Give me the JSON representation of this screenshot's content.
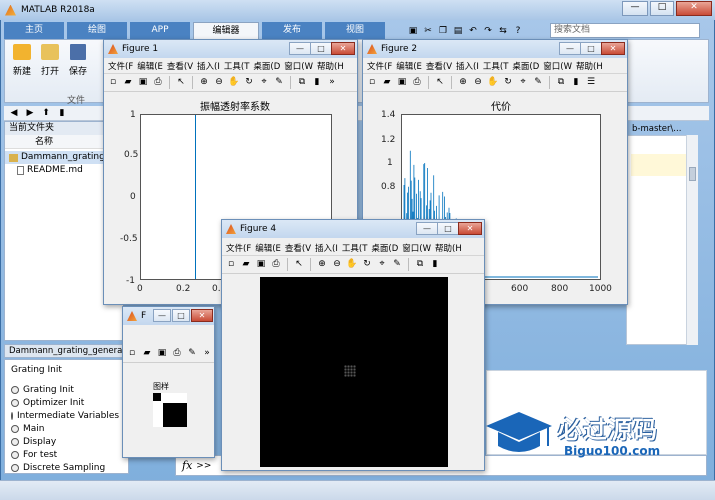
{
  "app": {
    "title": "MATLAB R2018a",
    "search_placeholder": "搜索文档",
    "tabs": [
      "主页",
      "绘图",
      "APP",
      "编辑器",
      "发布",
      "视图"
    ],
    "ribbon": {
      "new": "新建",
      "open": "打开",
      "save": "保存",
      "group": "文件"
    }
  },
  "left_panel": {
    "header": "当前文件夹",
    "column": "名称",
    "files": [
      "Dammann_grating",
      "README.md"
    ]
  },
  "editor_tab_label": "Dammann_grating_generator",
  "path_fragment": "b-master\\...",
  "outline": {
    "heading": "Grating Init",
    "items": [
      "Grating Init",
      "Optimizer Init",
      "Intermediate Variables I",
      "Main",
      "Display",
      "For test",
      "Discrete Sampling"
    ]
  },
  "command": {
    "fx": "fx",
    "prompt": ">>"
  },
  "watermark": {
    "main": "必过源码",
    "sub": "Biguo100.com"
  },
  "fig_menu": [
    "文件(F",
    "编辑(E",
    "查看(V",
    "插入(I",
    "工具(T",
    "桌面(D",
    "窗口(W",
    "帮助(H"
  ],
  "fig_menu4": [
    "文件(F",
    "编辑(E",
    "查看(V",
    "插入(I",
    "工具(T",
    "桌面(D",
    "窗口(W",
    "帮助(H"
  ],
  "figure1": {
    "title": "Figure 1",
    "chart_data": {
      "type": "line",
      "title": "振幅透射率系数",
      "yticks": [
        "1",
        "0.5",
        "0",
        "-0.5",
        "-1"
      ],
      "xticks": [
        "0",
        "0.2",
        "0.4"
      ],
      "ylim": [
        -1,
        1
      ]
    }
  },
  "figure2": {
    "title": "Figure 2",
    "chart_data": {
      "type": "line",
      "title": "代价",
      "yticks": [
        "1.4",
        "1.2",
        "1",
        "0.8"
      ],
      "xticks": [
        "600",
        "800",
        "1000"
      ],
      "ylim": [
        0,
        1.4
      ]
    }
  },
  "figure3": {
    "title": "F",
    "label": "图样"
  },
  "figure4": {
    "title": "Figure 4"
  },
  "colors": {
    "matlab_blue": "#0072bd",
    "axis": "#555555"
  }
}
